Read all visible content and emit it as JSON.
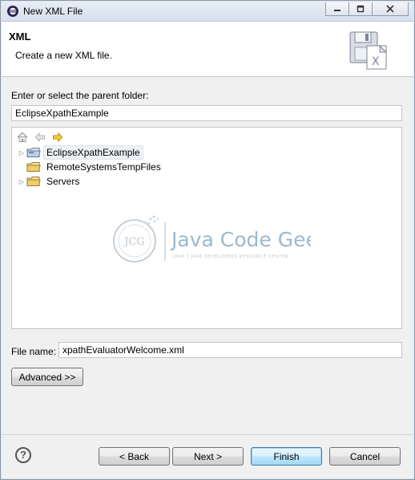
{
  "window": {
    "title": "New XML File"
  },
  "header": {
    "title": "XML",
    "description": "Create a new XML file."
  },
  "parent_folder": {
    "label": "Enter or select the parent folder:",
    "value": "EclipseXpathExample"
  },
  "tree": {
    "items": [
      {
        "label": "EclipseXpathExample",
        "expandable": true,
        "selected": true
      },
      {
        "label": "RemoteSystemsTempFiles",
        "expandable": false,
        "selected": false
      },
      {
        "label": "Servers",
        "expandable": true,
        "selected": false
      }
    ]
  },
  "watermark": {
    "logo_text": "JCG",
    "brand": "Java Code Geeks",
    "tagline": "JAVA 2 JAVA DEVELOPERS RESOURCE CENTER"
  },
  "file_name": {
    "label": "File name:",
    "value": "xpathEvaluatorWelcome.xml"
  },
  "buttons": {
    "advanced": "Advanced >>",
    "back": "< Back",
    "next": "Next >",
    "finish": "Finish",
    "cancel": "Cancel",
    "help": "?"
  }
}
